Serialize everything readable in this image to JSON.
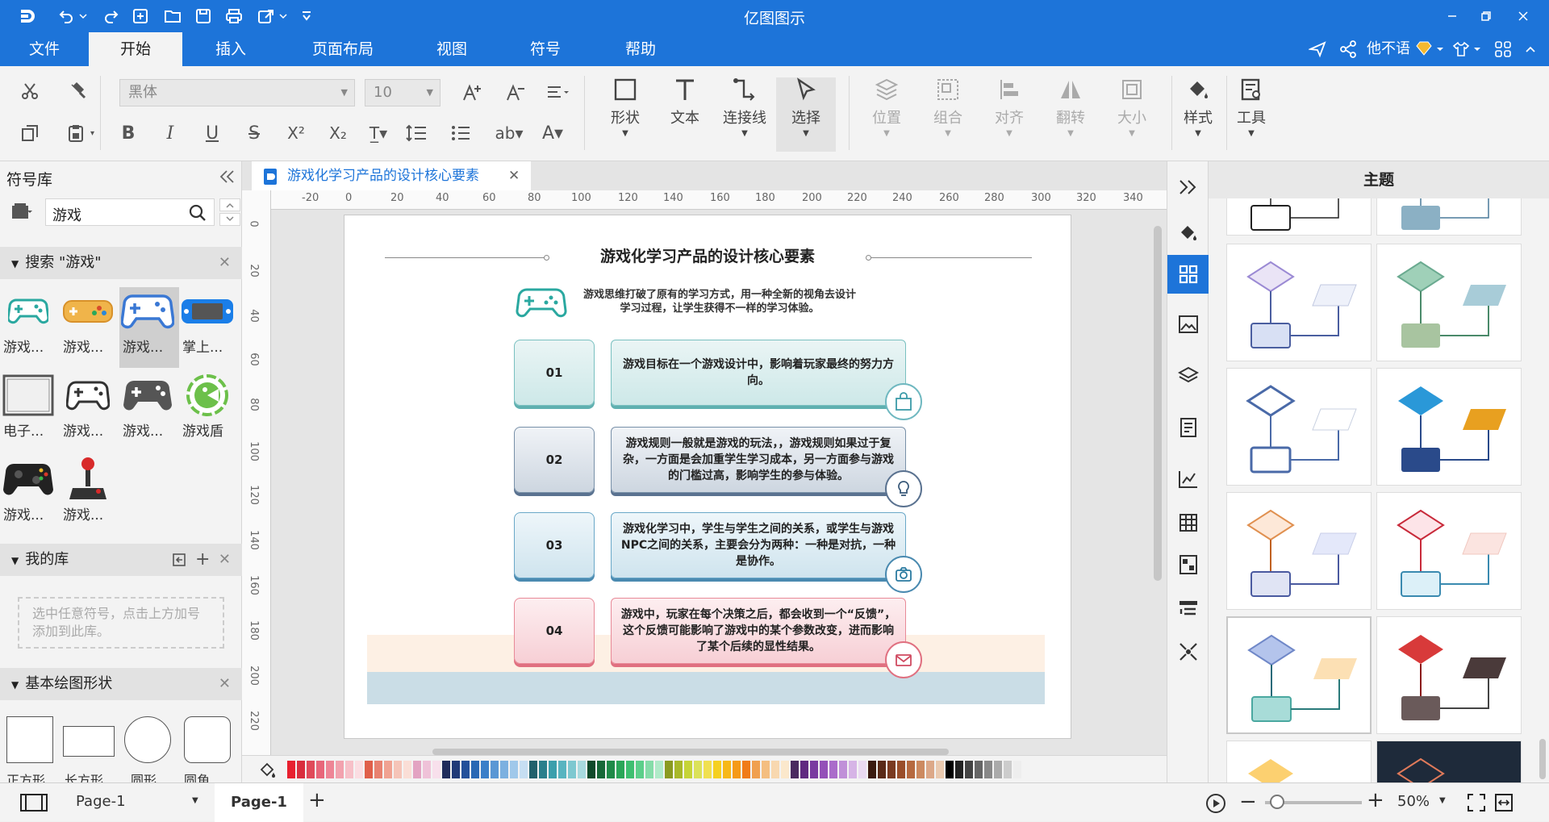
{
  "app": {
    "title": "亿图图示"
  },
  "menu": {
    "items": [
      "文件",
      "开始",
      "插入",
      "页面布局",
      "视图",
      "符号",
      "帮助"
    ],
    "active": "开始"
  },
  "user": {
    "name": "他不语"
  },
  "ribbon": {
    "font_name": "黑体",
    "font_size": "10",
    "tools": [
      "形状",
      "文本",
      "连接线",
      "选择"
    ],
    "arrange": [
      "位置",
      "组合",
      "对齐",
      "翻转",
      "大小"
    ],
    "style": "样式",
    "tools_label": "工具"
  },
  "left": {
    "title": "符号库",
    "search_value": "游戏",
    "search_section": "搜索 \"游戏\"",
    "symbols": [
      "游戏...",
      "游戏...",
      "游戏...",
      "掌上...",
      "电子...",
      "游戏...",
      "游戏...",
      "游戏盾",
      "游戏...",
      "游戏..."
    ],
    "my_lib": "我的库",
    "my_lib_hint": "选中任意符号，点击上方加号添加到此库。",
    "basic_shapes": "基本绘图形状",
    "shapes": [
      "正方形",
      "长方形",
      "圆形",
      "圆角..."
    ]
  },
  "doc": {
    "tab": "游戏化学习产品的设计核心要素",
    "title": "游戏化学习产品的设计核心要素",
    "intro": "游戏思维打破了原有的学习方式，用一种全新的视角去设计学习过程，让学生获得不一样的学习体验。",
    "items": [
      {
        "num": "01",
        "text": "游戏目标在一个游戏设计中，影响着玩家最终的努力方向。"
      },
      {
        "num": "02",
        "text": "游戏规则一般就是游戏的玩法，，游戏规则如果过于复杂，一方面是会加重学生学习成本，另一方面参与游戏的门槛过高，影响学生的参与体验。"
      },
      {
        "num": "03",
        "text": "游戏化学习中，学生与学生之间的关系，或学生与游戏NPC之间的关系，主要会分为两种：一种是对抗，一种是协作。"
      },
      {
        "num": "04",
        "text": "游戏中，玩家在每个决策之后，都会收到一个“反馈”，这个反馈可能影响了游戏中的某个参数改变，进而影响了某个后续的显性结果。"
      }
    ]
  },
  "ruler": {
    "h": [
      "-20",
      "0",
      "20",
      "40",
      "60",
      "80",
      "100",
      "120",
      "140",
      "160",
      "180",
      "200",
      "220",
      "240",
      "260",
      "280",
      "300",
      "320",
      "340"
    ],
    "v": [
      "0",
      "20",
      "40",
      "60",
      "80",
      "100",
      "120",
      "140",
      "160",
      "180",
      "200",
      "220"
    ]
  },
  "status": {
    "page_select": "Page-1",
    "page_tab": "Page-1",
    "zoom": "50%"
  },
  "theme": {
    "title": "主题"
  },
  "colors": {
    "accent": "#1d74d9",
    "palette": [
      "#e8202f",
      "#d92e3e",
      "#e04a5a",
      "#e8667a",
      "#ee8596",
      "#f2a2ae",
      "#f7c0c8",
      "#fbdde2",
      "#e05f4a",
      "#e88170",
      "#f0a292",
      "#f5c4b8",
      "#faded6",
      "#e3a3c2",
      "#efc2d8",
      "#f8e0ec",
      "#1f2d5c",
      "#203a78",
      "#22509a",
      "#2868b4",
      "#3a7fc8",
      "#5a97d4",
      "#7cb0e0",
      "#a0c8ea",
      "#c6def2",
      "#20606c",
      "#2a7f8c",
      "#3a9fac",
      "#58b4c0",
      "#7ec8d0",
      "#a8dadf",
      "#0f4a2a",
      "#176838",
      "#1f8a48",
      "#2aa658",
      "#3ebf70",
      "#5ccf8a",
      "#85dca8",
      "#b0eac8",
      "#8a9a20",
      "#a8b828",
      "#c6d438",
      "#dbe25a",
      "#f0e050",
      "#f5d020",
      "#f7b818",
      "#f59a18",
      "#f07c18",
      "#f0a050",
      "#f4be80",
      "#f8d8b0",
      "#fbe8cc",
      "#4a2a60",
      "#602a80",
      "#7a3aa0",
      "#9450b8",
      "#aa6cca",
      "#c090d8",
      "#d6b4e6",
      "#eadaf2",
      "#3a1a0f",
      "#5a2a18",
      "#7a3a20",
      "#9a4e2a",
      "#b66a40",
      "#cc8a60",
      "#dca888",
      "#eacab0",
      "#000000",
      "#222222",
      "#444444",
      "#666666",
      "#888888",
      "#aaaaaa",
      "#cccccc",
      "#eeeeee"
    ]
  }
}
